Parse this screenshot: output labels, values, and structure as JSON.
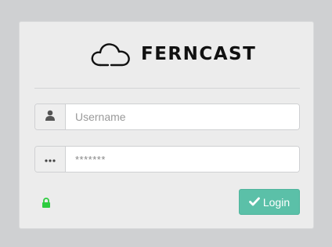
{
  "brand": {
    "name": "FERNCAST",
    "logo_icon": "cloud-icon"
  },
  "form": {
    "username": {
      "placeholder": "Username",
      "icon": "user-icon"
    },
    "password": {
      "value": "*******",
      "icon": "dots-icon"
    },
    "lock_icon": "lock-icon",
    "login_button": {
      "label": "Login",
      "icon": "check-icon"
    }
  },
  "colors": {
    "background": "#cfd0d2",
    "panel": "#ececec",
    "accent": "#5bc0a8",
    "lock": "#2ecc40"
  }
}
